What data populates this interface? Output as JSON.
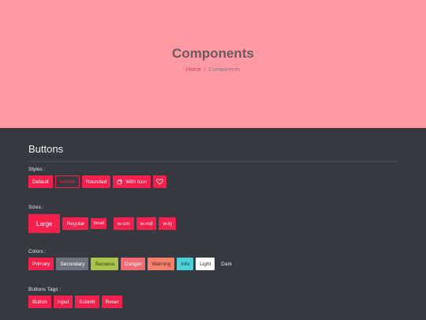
{
  "hero": {
    "title": "Components",
    "breadcrumb": {
      "home": "Home",
      "separator": "/",
      "current": "Components"
    }
  },
  "section": {
    "title": "Buttons"
  },
  "styles": {
    "label": "Styles :",
    "buttons": [
      "Default",
      "outline",
      "Rounded",
      "With Icon"
    ]
  },
  "sizes": {
    "label": "Sizes :",
    "buttons": [
      "Large",
      "Regular",
      "Small",
      "w-sm",
      "w-md",
      "w-lg"
    ]
  },
  "colors": {
    "label": "Colors :",
    "buttons": [
      "Primary",
      "Secondary",
      "Success",
      "Danger",
      "Warning",
      "Info",
      "Light",
      "Dark"
    ]
  },
  "tags": {
    "label": "Buttons Tags :",
    "buttons": [
      "Button",
      "Input",
      "Submit",
      "Reset"
    ]
  },
  "icons": {
    "with_icon": "box-icon",
    "heart": "heart-icon"
  },
  "palette": {
    "hero_bg": "#ff9aa5",
    "dark_bg": "#343a40",
    "primary": "#f5204b",
    "secondary": "#6c757d",
    "success": "#a8c74a",
    "danger": "#f26a72",
    "warning": "#f6806a",
    "info": "#4cd0d9",
    "light": "#ffffff"
  }
}
